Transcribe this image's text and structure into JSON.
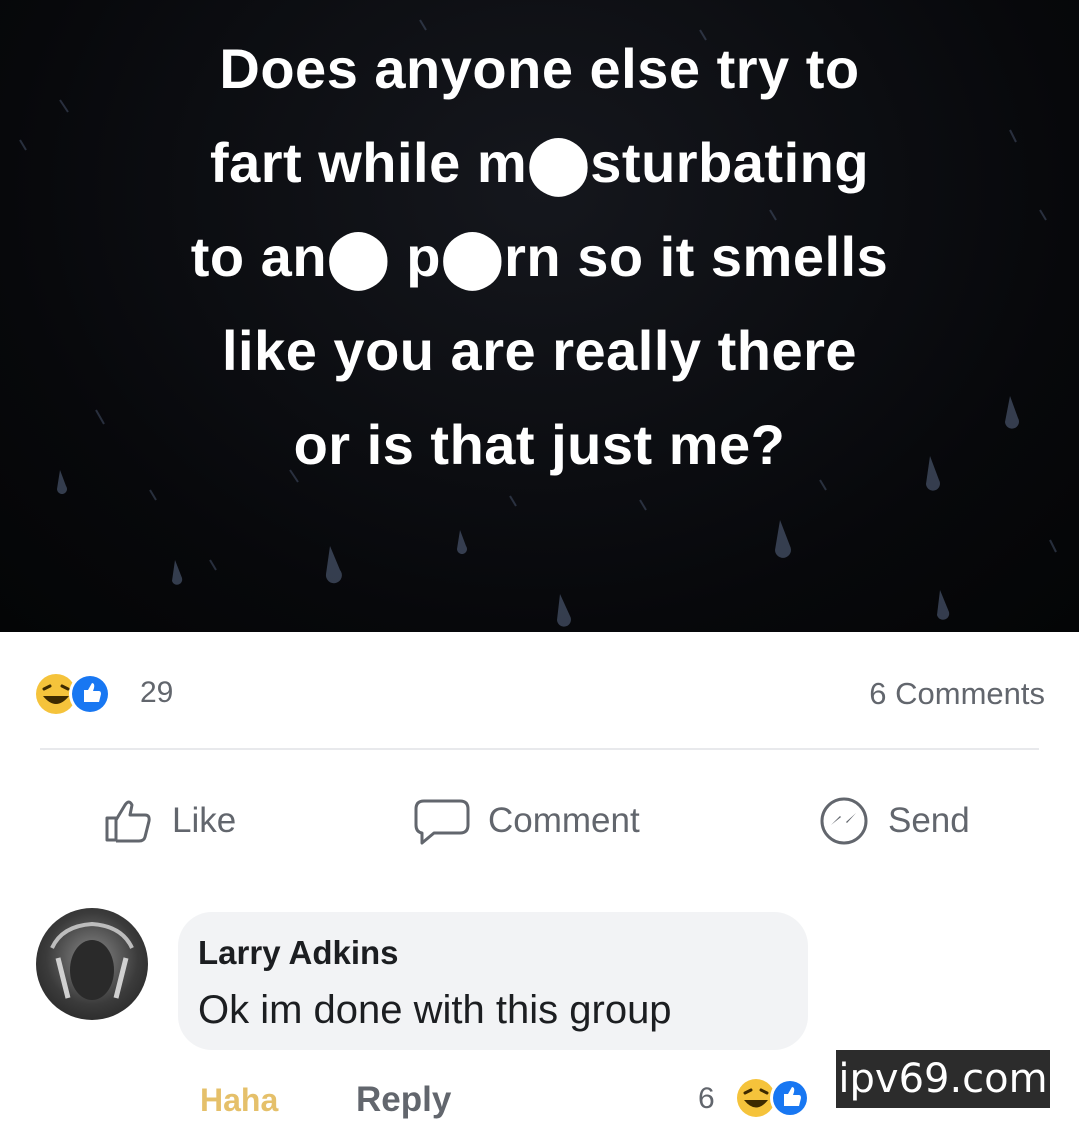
{
  "post": {
    "text_lines": [
      "Does anyone else try to",
      "fart while m⬤sturbating",
      "to an⬤ p⬤rn so it smells",
      "like you are really there",
      "or is that just me?"
    ]
  },
  "reactions": {
    "icons": [
      "haha-icon",
      "like-icon"
    ],
    "count": "29",
    "comments_count": "6 Comments"
  },
  "actions": {
    "like_label": "Like",
    "comment_label": "Comment",
    "send_label": "Send"
  },
  "comment": {
    "author": "Larry Adkins",
    "text": "Ok im done with this group",
    "haha_label": "Haha",
    "reply_label": "Reply",
    "reaction_count": "6"
  },
  "watermark": "ipv69.com",
  "colors": {
    "haha_yellow": "#f5c33b",
    "like_blue": "#1877f2",
    "muted_text": "#62666d"
  }
}
